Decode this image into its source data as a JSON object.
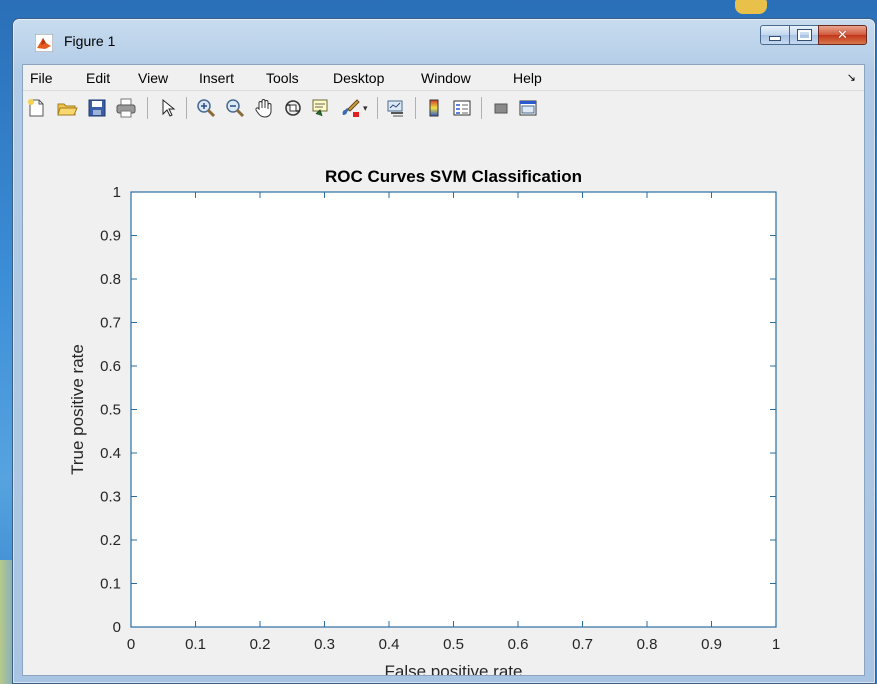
{
  "window": {
    "title": "Figure 1",
    "minimize_label": "Minimize",
    "maximize_label": "Maximize",
    "close_label": "Close"
  },
  "menu": {
    "items": [
      "File",
      "Edit",
      "View",
      "Insert",
      "Tools",
      "Desktop",
      "Window",
      "Help"
    ]
  },
  "toolbar": {
    "icons": [
      "new-figure-icon",
      "open-file-icon",
      "save-icon",
      "print-icon",
      "pointer-icon",
      "zoom-in-icon",
      "zoom-out-icon",
      "pan-hand-icon",
      "rotate-3d-icon",
      "data-cursor-icon",
      "brush-icon",
      "link-plot-icon",
      "colorbar-icon",
      "legend-icon",
      "hide-plot-tools-icon",
      "show-plot-tools-icon"
    ]
  },
  "chart_data": {
    "type": "line",
    "title": "ROC Curves SVM Classification",
    "xlabel": "False positive rate",
    "ylabel": "True positive rate",
    "xlim": [
      0,
      1
    ],
    "ylim": [
      0,
      1
    ],
    "xticks": [
      "0",
      "0.1",
      "0.2",
      "0.3",
      "0.4",
      "0.5",
      "0.6",
      "0.7",
      "0.8",
      "0.9",
      "1"
    ],
    "yticks": [
      "0",
      "0.1",
      "0.2",
      "0.3",
      "0.4",
      "0.5",
      "0.6",
      "0.7",
      "0.8",
      "0.9",
      "1"
    ],
    "grid": false,
    "series": [],
    "colors": {
      "axis": "#2a6fa0",
      "text": "#262626"
    }
  }
}
